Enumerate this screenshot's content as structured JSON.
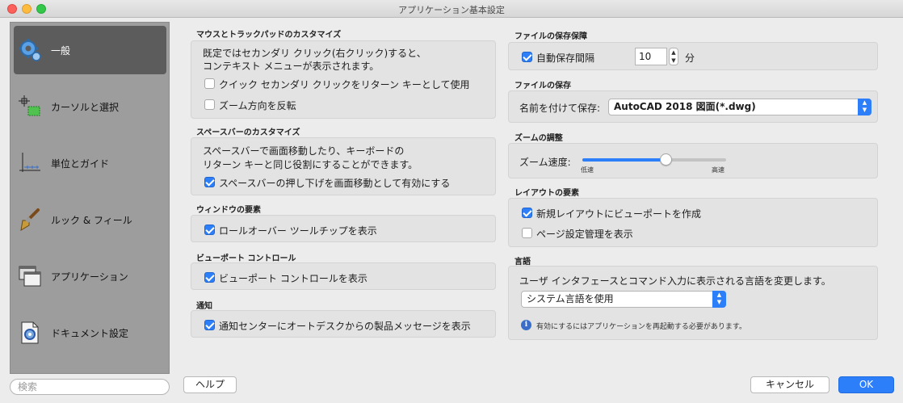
{
  "window": {
    "title": "アプリケーション基本設定"
  },
  "sidebar": {
    "items": [
      {
        "label": "一般",
        "icon": "gear-icon",
        "active": true
      },
      {
        "label": "カーソルと選択",
        "icon": "cursor-selection-icon"
      },
      {
        "label": "単位とガイド",
        "icon": "units-guides-icon"
      },
      {
        "label": "ルック & フィール",
        "icon": "paintbrush-icon"
      },
      {
        "label": "アプリケーション",
        "icon": "application-windows-icon"
      },
      {
        "label": "ドキュメント設定",
        "icon": "document-settings-icon"
      }
    ],
    "search_placeholder": "検索"
  },
  "mouse": {
    "title": "マウスとトラックパッドのカスタマイズ",
    "desc1": "既定ではセカンダリ クリック(右クリック)すると、",
    "desc2": "コンテキスト メニューが表示されます。",
    "quick_click": {
      "label": "クイック セカンダリ クリックをリターン キーとして使用",
      "checked": false
    },
    "zoom_reverse": {
      "label": "ズーム方向を反転",
      "checked": false
    }
  },
  "spacebar": {
    "title": "スペースバーのカスタマイズ",
    "desc1": "スペースバーで画面移動したり、キーボードの",
    "desc2": "リターン キーと同じ役割にすることができます。",
    "enable_pan": {
      "label": "スペースバーの押し下げを画面移動として有効にする",
      "checked": true
    }
  },
  "window_elements": {
    "title": "ウィンドウの要素",
    "rollover": {
      "label": "ロールオーバー ツールチップを表示",
      "checked": true
    }
  },
  "viewport_control": {
    "title": "ビューポート コントロール",
    "show": {
      "label": "ビューポート コントロールを表示",
      "checked": true
    }
  },
  "notification": {
    "title": "通知",
    "show": {
      "label": "通知センターにオートデスクからの製品メッセージを表示",
      "checked": true
    }
  },
  "file_safety": {
    "title": "ファイルの保存保障",
    "autosave": {
      "label": "自動保存間隔",
      "checked": true
    },
    "interval_value": "10",
    "unit": "分"
  },
  "file_save": {
    "title": "ファイルの保存",
    "label": "名前を付けて保存:",
    "format": "AutoCAD 2018 図面(*.dwg)"
  },
  "zoom": {
    "title": "ズームの調整",
    "label": "ズーム速度:",
    "min_label": "低速",
    "max_label": "高速",
    "value_fraction": 0.58
  },
  "layout": {
    "title": "レイアウトの要素",
    "new_viewport": {
      "label": "新規レイアウトにビューポートを作成",
      "checked": true
    },
    "page_setup": {
      "label": "ページ設定管理を表示",
      "checked": false
    }
  },
  "language": {
    "title": "言語",
    "desc": "ユーザ インタフェースとコマンド入力に表示される言語を変更します。",
    "selected": "システム言語を使用",
    "info": "有効にするにはアプリケーションを再起動する必要があります。"
  },
  "buttons": {
    "help": "ヘルプ",
    "cancel": "キャンセル",
    "ok": "OK"
  },
  "colors": {
    "accent": "#2d7ff9",
    "sidebar": "#9d9d9d",
    "sidebar_active": "#5c5c5c"
  }
}
